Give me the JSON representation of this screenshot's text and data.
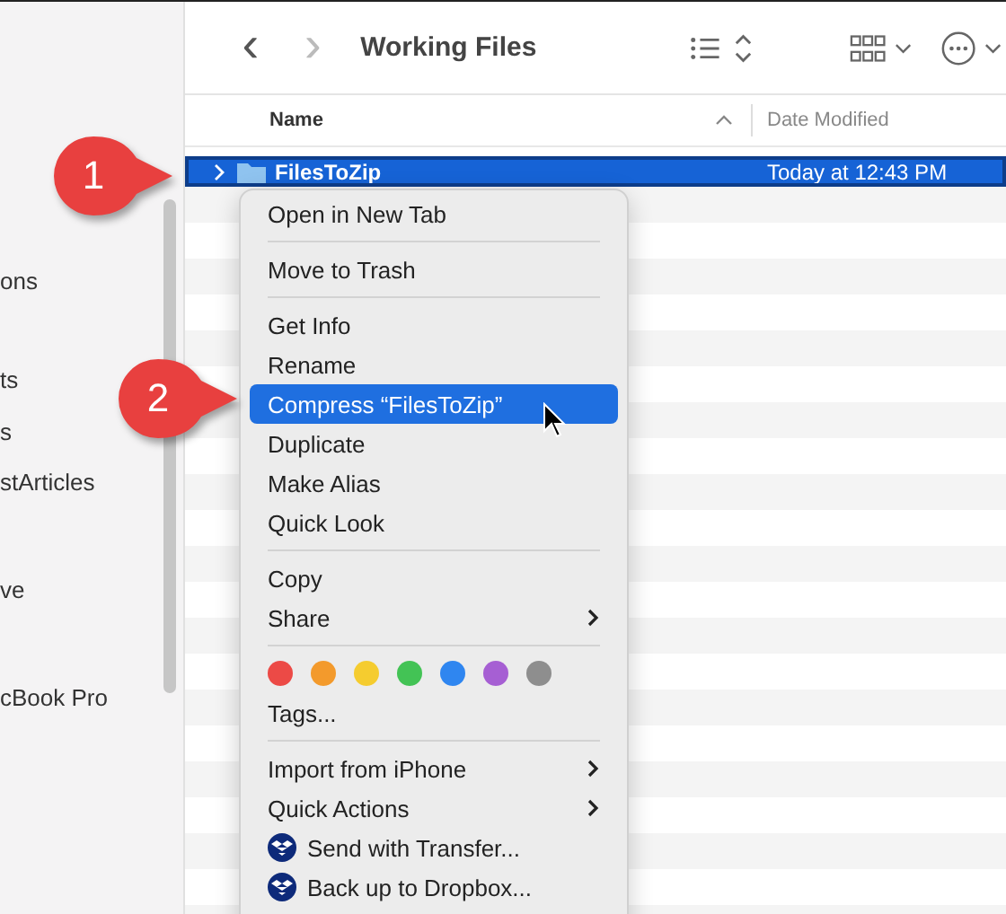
{
  "sidebar": {
    "items": [
      {
        "label": "ons"
      },
      {
        "label": "ts"
      },
      {
        "label": "s"
      },
      {
        "label": "stArticles"
      },
      {
        "label": "ve"
      },
      {
        "label": "cBook Pro"
      }
    ]
  },
  "toolbar": {
    "back": "‹",
    "forward": "›",
    "forward_disabled": true,
    "title": "Working Files"
  },
  "table": {
    "columns": [
      {
        "label": "Name",
        "sorted": true
      },
      {
        "label": "Date Modified",
        "sorted": false
      }
    ],
    "rows": [
      {
        "name": "FilesToZip",
        "date": "Today at 12:43 PM",
        "selected": true
      }
    ]
  },
  "menu": {
    "items": [
      {
        "kind": "item",
        "label": "Open in New Tab",
        "selected": false
      },
      {
        "kind": "separator"
      },
      {
        "kind": "item",
        "label": "Move to Trash",
        "selected": false
      },
      {
        "kind": "separator"
      },
      {
        "kind": "item",
        "label": "Get Info",
        "selected": false
      },
      {
        "kind": "item",
        "label": "Rename",
        "selected": false
      },
      {
        "kind": "item",
        "label": "Compress “FilesToZip”",
        "selected": true
      },
      {
        "kind": "item",
        "label": "Duplicate",
        "selected": false
      },
      {
        "kind": "item",
        "label": "Make Alias",
        "selected": false
      },
      {
        "kind": "item",
        "label": "Quick Look",
        "selected": false
      },
      {
        "kind": "separator"
      },
      {
        "kind": "item",
        "label": "Copy",
        "selected": false
      },
      {
        "kind": "submenu",
        "label": "Share",
        "selected": false
      },
      {
        "kind": "separator"
      },
      {
        "kind": "tags",
        "tags": [
          {
            "color": "#ec4a46"
          },
          {
            "color": "#f39a2c"
          },
          {
            "color": "#f5cc2f"
          },
          {
            "color": "#43c355"
          },
          {
            "color": "#2f86f0"
          },
          {
            "color": "#a65fd3"
          },
          {
            "color": "#8e8e8e"
          }
        ]
      },
      {
        "kind": "item",
        "label": "Tags...",
        "selected": false
      },
      {
        "kind": "separator"
      },
      {
        "kind": "submenu",
        "label": "Import from iPhone",
        "selected": false
      },
      {
        "kind": "submenu",
        "label": "Quick Actions",
        "selected": false
      },
      {
        "kind": "service",
        "label": "Send with Transfer...",
        "selected": false
      },
      {
        "kind": "service",
        "label": "Back up to Dropbox...",
        "selected": false
      }
    ]
  },
  "callouts": [
    {
      "number": "1"
    },
    {
      "number": "2"
    }
  ]
}
